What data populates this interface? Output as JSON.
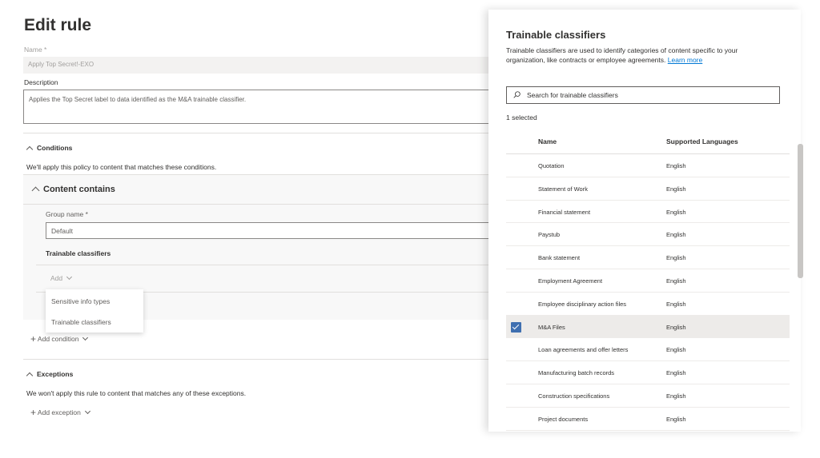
{
  "form": {
    "title": "Edit rule",
    "name_label": "Name *",
    "name_value": "Apply Top Secret!-EXO",
    "description_label": "Description",
    "description_value": "Applies the Top Secret label to data identified as the M&A trainable classifier.",
    "conditions": {
      "heading": "Conditions",
      "intro": "We'll apply this policy to content that matches these conditions.",
      "content_contains": "Content contains",
      "group_name_label": "Group name *",
      "group_name_value": "Default",
      "trainable_classifiers_label": "Trainable classifiers",
      "add_label": "Add",
      "add_menu": [
        "Sensitive info types",
        "Trainable classifiers"
      ],
      "add_condition": "Add condition"
    },
    "exceptions": {
      "heading": "Exceptions",
      "intro": "We won't apply this rule to content that matches any of these exceptions.",
      "add_exception": "Add exception"
    }
  },
  "panel": {
    "title": "Trainable classifiers",
    "description": "Trainable classifiers are used to identify categories of content specific to your organization, like contracts or employee agreements.",
    "learn_more": "Learn more",
    "search_placeholder": "Search for trainable classifiers",
    "selected_count": "1 selected",
    "columns": {
      "name": "Name",
      "languages": "Supported Languages"
    },
    "rows": [
      {
        "name": "Quotation",
        "language": "English",
        "selected": false
      },
      {
        "name": "Statement of Work",
        "language": "English",
        "selected": false
      },
      {
        "name": "Financial statement",
        "language": "English",
        "selected": false
      },
      {
        "name": "Paystub",
        "language": "English",
        "selected": false
      },
      {
        "name": "Bank statement",
        "language": "English",
        "selected": false
      },
      {
        "name": "Employment Agreement",
        "language": "English",
        "selected": false
      },
      {
        "name": "Employee disciplinary action files",
        "language": "English",
        "selected": false
      },
      {
        "name": "M&A Files",
        "language": "English",
        "selected": true
      },
      {
        "name": "Loan agreements and offer letters",
        "language": "English",
        "selected": false
      },
      {
        "name": "Manufacturing batch records",
        "language": "English",
        "selected": false
      },
      {
        "name": "Construction specifications",
        "language": "English",
        "selected": false
      },
      {
        "name": "Project documents",
        "language": "English",
        "selected": false
      }
    ],
    "checkbox_color": "#3f6fb0",
    "selected_row_color": "#edebe9",
    "link_color": "#0078d4"
  }
}
